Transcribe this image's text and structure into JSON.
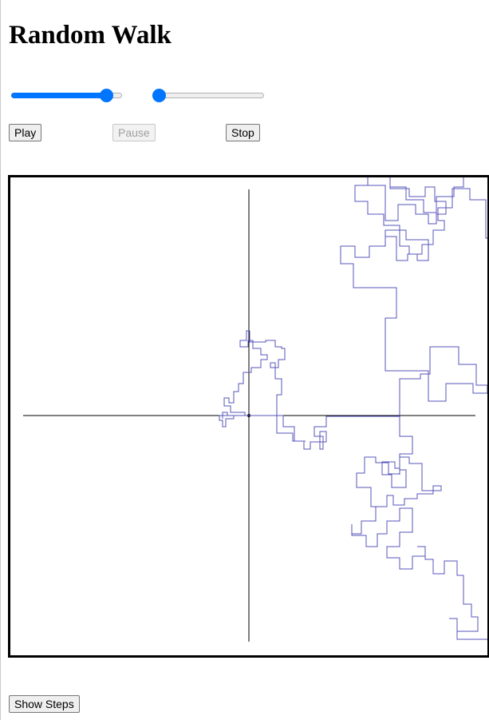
{
  "page": {
    "title": "Random Walk"
  },
  "controls": {
    "speed_slider": {
      "value_fraction": 0.85
    },
    "step_slider": {
      "value_fraction": 0.05
    }
  },
  "buttons": {
    "play_label": "Play",
    "pause_label": "Pause",
    "stop_label": "Stop",
    "show_steps_label": "Show Steps"
  },
  "canvas": {
    "walk_color": "#5555bb",
    "axis_color": "#000000"
  }
}
